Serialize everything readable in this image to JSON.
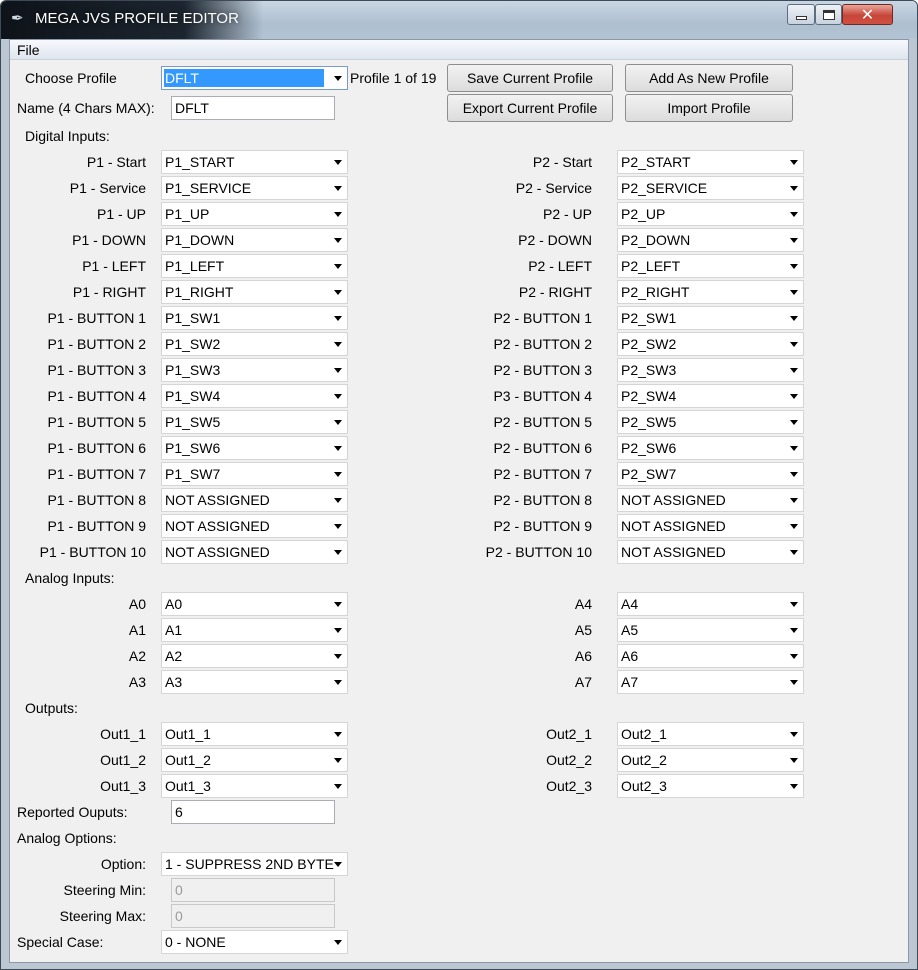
{
  "window": {
    "title": "MEGA JVS PROFILE EDITOR"
  },
  "menu": {
    "file": "File"
  },
  "profile": {
    "choose_label": "Choose Profile",
    "selected": "DFLT",
    "counter": "Profile 1 of 19",
    "name_label": "Name (4 Chars MAX):",
    "name_value": "DFLT"
  },
  "buttons": {
    "save": "Save Current Profile",
    "add": "Add As New Profile",
    "export": "Export Current Profile",
    "import": "Import Profile"
  },
  "digital": {
    "header": "Digital Inputs:",
    "p1": [
      {
        "label": "P1 - Start",
        "value": "P1_START"
      },
      {
        "label": "P1 - Service",
        "value": "P1_SERVICE"
      },
      {
        "label": "P1 - UP",
        "value": "P1_UP"
      },
      {
        "label": "P1 - DOWN",
        "value": "P1_DOWN"
      },
      {
        "label": "P1 - LEFT",
        "value": "P1_LEFT"
      },
      {
        "label": "P1 - RIGHT",
        "value": "P1_RIGHT"
      },
      {
        "label": "P1 - BUTTON 1",
        "value": "P1_SW1"
      },
      {
        "label": "P1 - BUTTON 2",
        "value": "P1_SW2"
      },
      {
        "label": "P1 - BUTTON 3",
        "value": "P1_SW3"
      },
      {
        "label": "P1 - BUTTON 4",
        "value": "P1_SW4"
      },
      {
        "label": "P1 - BUTTON 5",
        "value": "P1_SW5"
      },
      {
        "label": "P1 - BUTTON 6",
        "value": "P1_SW6"
      },
      {
        "label": "P1 - BUTTON 7",
        "value": "P1_SW7"
      },
      {
        "label": "P1 - BUTTON 8",
        "value": "NOT ASSIGNED"
      },
      {
        "label": "P1 - BUTTON 9",
        "value": "NOT ASSIGNED"
      },
      {
        "label": "P1 - BUTTON 10",
        "value": "NOT ASSIGNED"
      }
    ],
    "p2": [
      {
        "label": "P2 - Start",
        "value": "P2_START"
      },
      {
        "label": "P2 - Service",
        "value": "P2_SERVICE"
      },
      {
        "label": "P2 - UP",
        "value": "P2_UP"
      },
      {
        "label": "P2 - DOWN",
        "value": "P2_DOWN"
      },
      {
        "label": "P2 - LEFT",
        "value": "P2_LEFT"
      },
      {
        "label": "P2 - RIGHT",
        "value": "P2_RIGHT"
      },
      {
        "label": "P2 - BUTTON 1",
        "value": "P2_SW1"
      },
      {
        "label": "P2 - BUTTON 2",
        "value": "P2_SW2"
      },
      {
        "label": "P2 - BUTTON 3",
        "value": "P2_SW3"
      },
      {
        "label": "P3 - BUTTON 4",
        "value": "P2_SW4"
      },
      {
        "label": "P2 - BUTTON 5",
        "value": "P2_SW5"
      },
      {
        "label": "P2 - BUTTON 6",
        "value": "P2_SW6"
      },
      {
        "label": "P2 - BUTTON 7",
        "value": "P2_SW7"
      },
      {
        "label": "P2 - BUTTON 8",
        "value": "NOT ASSIGNED"
      },
      {
        "label": "P2 - BUTTON 9",
        "value": "NOT ASSIGNED"
      },
      {
        "label": "P2 - BUTTON 10",
        "value": "NOT ASSIGNED"
      }
    ]
  },
  "analog": {
    "header": "Analog Inputs:",
    "left": [
      {
        "label": "A0",
        "value": "A0"
      },
      {
        "label": "A1",
        "value": "A1"
      },
      {
        "label": "A2",
        "value": "A2"
      },
      {
        "label": "A3",
        "value": "A3"
      }
    ],
    "right": [
      {
        "label": "A4",
        "value": "A4"
      },
      {
        "label": "A5",
        "value": "A5"
      },
      {
        "label": "A6",
        "value": "A6"
      },
      {
        "label": "A7",
        "value": "A7"
      }
    ]
  },
  "outputs": {
    "header": "Outputs:",
    "left": [
      {
        "label": "Out1_1",
        "value": "Out1_1"
      },
      {
        "label": "Out1_2",
        "value": "Out1_2"
      },
      {
        "label": "Out1_3",
        "value": "Out1_3"
      }
    ],
    "right": [
      {
        "label": "Out2_1",
        "value": "Out2_1"
      },
      {
        "label": "Out2_2",
        "value": "Out2_2"
      },
      {
        "label": "Out2_3",
        "value": "Out2_3"
      }
    ],
    "reported_label": "Reported Ouputs:",
    "reported_value": "6"
  },
  "analog_options": {
    "header": "Analog Options:",
    "option_label": "Option:",
    "option_value": "1 - SUPPRESS 2ND BYTE",
    "steer_min_label": "Steering Min:",
    "steer_min_value": "0",
    "steer_max_label": "Steering Max:",
    "steer_max_value": "0",
    "special_label": "Special Case:",
    "special_value": "0 - NONE"
  }
}
